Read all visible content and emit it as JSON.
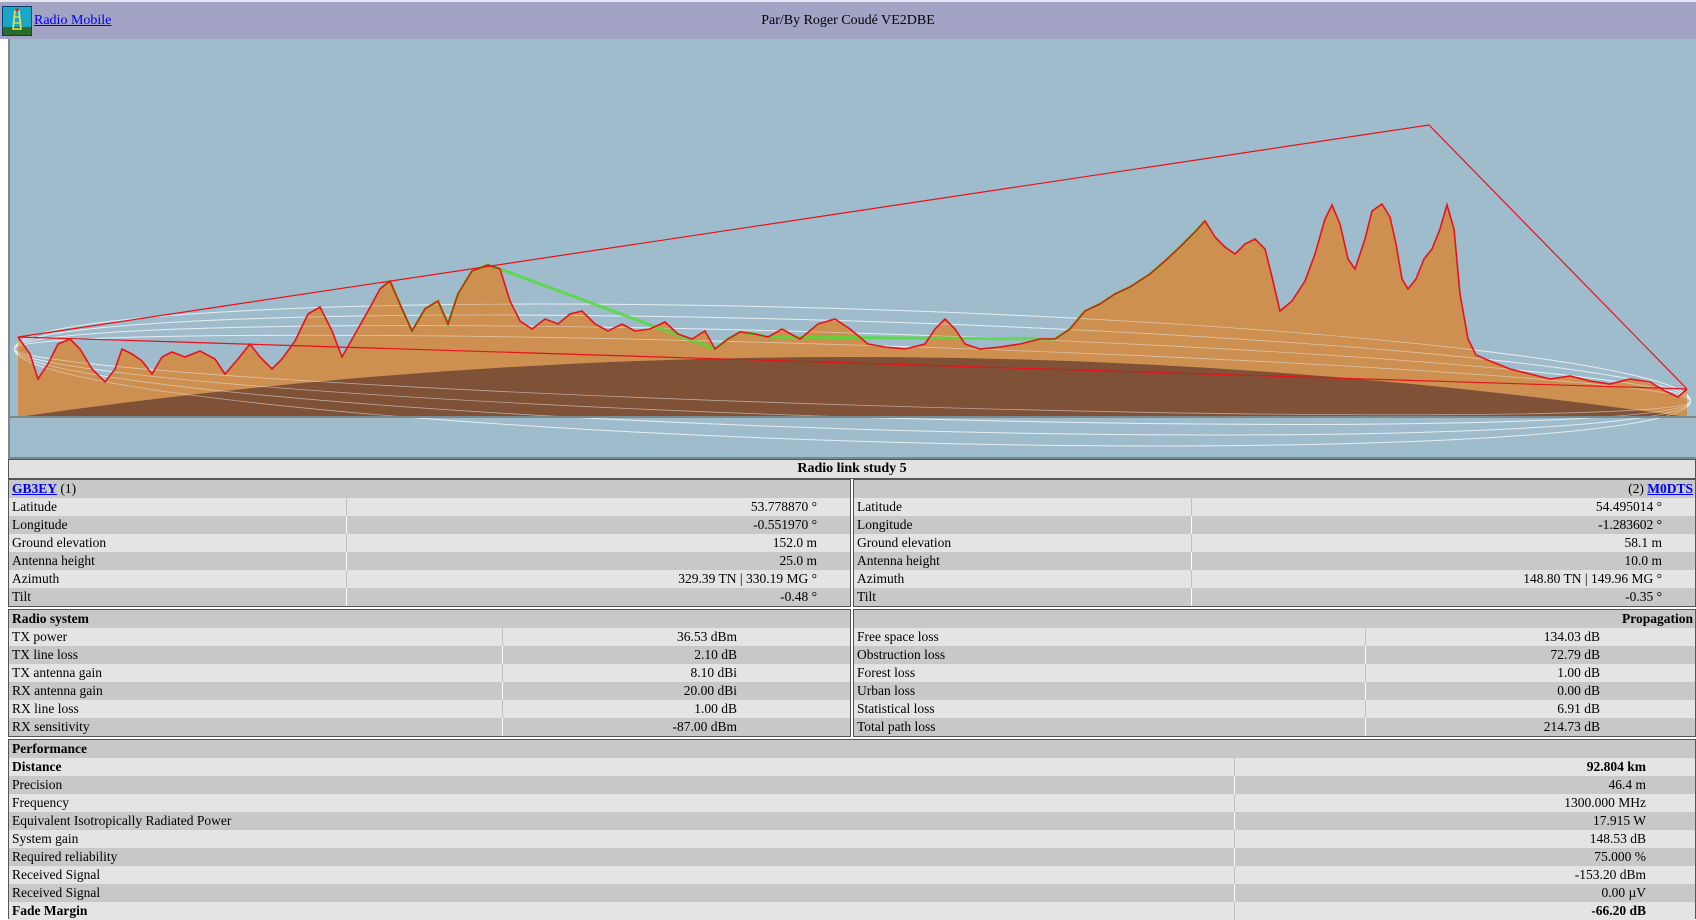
{
  "topbar": {
    "app_link": "Radio Mobile",
    "byline": "Par/By Roger Coudé VE2DBE",
    "logo_icon": "radio-tower-icon"
  },
  "profile": {
    "colors": {
      "sky": "#9fbccc",
      "terrain": "#cd9050",
      "earth_bulge": "#7f5136",
      "profile_line": "#e8121b",
      "fresnel": "#e8eef2",
      "vegetation": "#4fdc32",
      "dense_vegetation": "#1f5a1f"
    }
  },
  "study": {
    "title": "Radio link study 5"
  },
  "station1": {
    "name": "GB3EY",
    "index": "(1)",
    "rows": [
      {
        "label": "Latitude",
        "value": "53.778870 °"
      },
      {
        "label": "Longitude",
        "value": "-0.551970 °"
      },
      {
        "label": "Ground elevation",
        "value": "152.0 m"
      },
      {
        "label": "Antenna height",
        "value": "25.0 m"
      },
      {
        "label": "Azimuth",
        "value": "329.39 TN | 330.19 MG °"
      },
      {
        "label": "Tilt",
        "value": "-0.48 °"
      }
    ]
  },
  "station2": {
    "name": "M0DTS",
    "index": "(2)",
    "rows": [
      {
        "label": "Latitude",
        "value": "54.495014 °"
      },
      {
        "label": "Longitude",
        "value": "-1.283602 °"
      },
      {
        "label": "Ground elevation",
        "value": "58.1 m"
      },
      {
        "label": "Antenna height",
        "value": "10.0 m"
      },
      {
        "label": "Azimuth",
        "value": "148.80 TN | 149.96 MG °"
      },
      {
        "label": "Tilt",
        "value": "-0.35 °"
      }
    ]
  },
  "radio_system": {
    "heading": "Radio system",
    "rows": [
      {
        "label": "TX power",
        "value": "36.53 dBm"
      },
      {
        "label": "TX line loss",
        "value": "2.10 dB"
      },
      {
        "label": "TX antenna gain",
        "value": "8.10 dBi"
      },
      {
        "label": "RX antenna gain",
        "value": "20.00 dBi"
      },
      {
        "label": "RX line loss",
        "value": "1.00 dB"
      },
      {
        "label": "RX sensitivity",
        "value": "-87.00 dBm"
      }
    ]
  },
  "propagation": {
    "heading": "Propagation",
    "rows": [
      {
        "label": "Free space loss",
        "value": "134.03 dB"
      },
      {
        "label": "Obstruction loss",
        "value": "72.79 dB"
      },
      {
        "label": "Forest loss",
        "value": "1.00 dB"
      },
      {
        "label": "Urban loss",
        "value": "0.00 dB"
      },
      {
        "label": "Statistical loss",
        "value": "6.91 dB"
      },
      {
        "label": "Total path loss",
        "value": "214.73 dB"
      }
    ]
  },
  "performance": {
    "heading": "Performance",
    "rows": [
      {
        "label": "Distance",
        "value": "92.804 km",
        "bold": true
      },
      {
        "label": "Precision",
        "value": "46.4 m"
      },
      {
        "label": "Frequency",
        "value": "1300.000 MHz"
      },
      {
        "label": "Equivalent Isotropically Radiated Power",
        "value": "17.915 W"
      },
      {
        "label": "System gain",
        "value": "148.53 dB"
      },
      {
        "label": "Required reliability",
        "value": "75.000 %"
      },
      {
        "label": "Received Signal",
        "value": "-153.20 dBm"
      },
      {
        "label": "Received Signal",
        "value": "0.00 µV"
      },
      {
        "label": "Fade Margin",
        "value": "-66.20 dB",
        "bold": true
      }
    ]
  }
}
